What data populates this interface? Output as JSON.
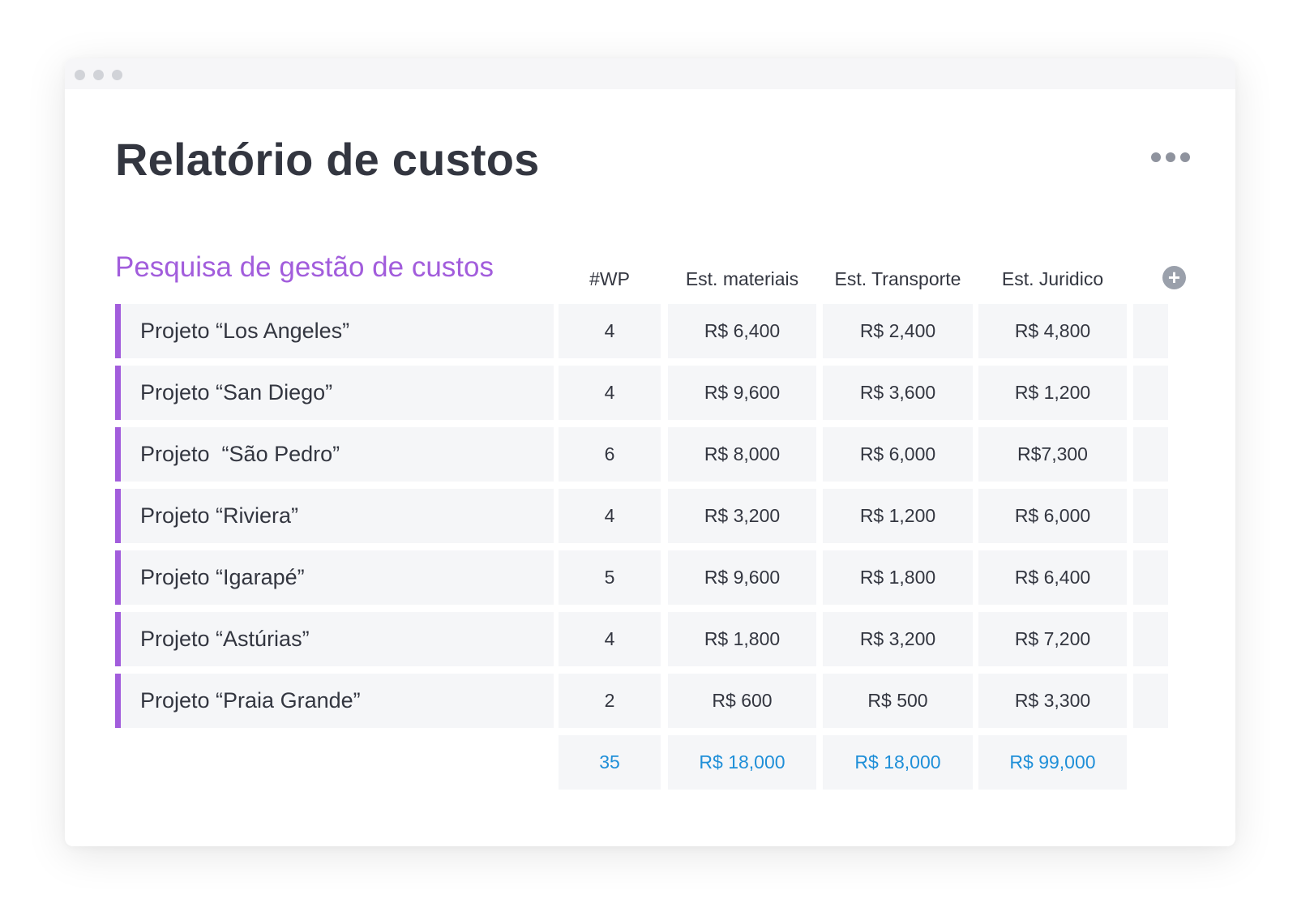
{
  "window": {
    "title": "Relatório de custos"
  },
  "group": {
    "title": "Pesquisa de gestão de custos"
  },
  "columns": [
    "#WP",
    "Est. materiais",
    "Est. Transporte",
    "Est. Juridico"
  ],
  "rows": [
    {
      "name": "Projeto “Los Angeles”",
      "wp": "4",
      "materiais": "R$ 6,400",
      "transporte": "R$ 2,400",
      "juridico": "R$ 4,800"
    },
    {
      "name": "Projeto “San Diego”",
      "wp": "4",
      "materiais": "R$ 9,600",
      "transporte": "R$ 3,600",
      "juridico": "R$ 1,200"
    },
    {
      "name": "Projeto  “São Pedro”",
      "wp": "6",
      "materiais": "R$ 8,000",
      "transporte": "R$ 6,000",
      "juridico": "R$7,300"
    },
    {
      "name": "Projeto “Riviera”",
      "wp": "4",
      "materiais": "R$ 3,200",
      "transporte": "R$ 1,200",
      "juridico": "R$ 6,000"
    },
    {
      "name": "Projeto “Igarapé”",
      "wp": "5",
      "materiais": "R$ 9,600",
      "transporte": "R$ 1,800",
      "juridico": "R$ 6,400"
    },
    {
      "name": "Projeto “Astúrias”",
      "wp": "4",
      "materiais": "R$ 1,800",
      "transporte": "R$ 3,200",
      "juridico": "R$ 7,200"
    },
    {
      "name": "Projeto “Praia Grande”",
      "wp": "2",
      "materiais": "R$ 600",
      "transporte": "R$ 500",
      "juridico": "R$ 3,300"
    }
  ],
  "totals": {
    "wp": "35",
    "materiais": "R$ 18,000",
    "transporte": "R$ 18,000",
    "juridico": "R$ 99,000"
  },
  "colors": {
    "group_accent": "#a25ddc",
    "totals_text": "#1f8fd8",
    "cell_background": "#f5f6f8"
  },
  "icons": {
    "more_menu": "more-horizontal-icon",
    "add_column": "plus-circle-icon"
  }
}
